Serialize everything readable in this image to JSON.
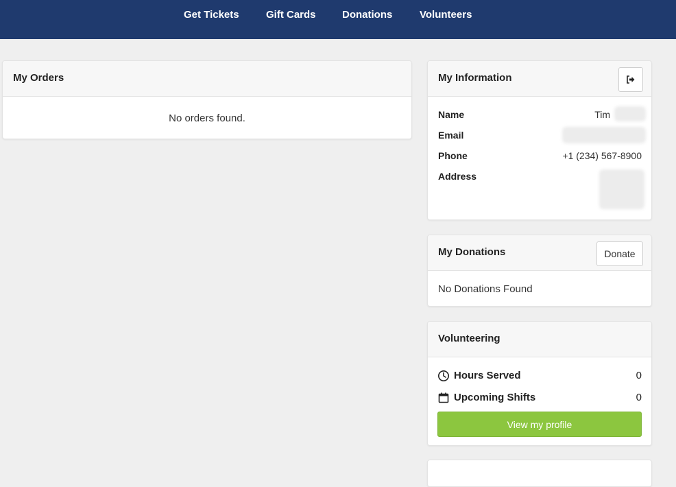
{
  "nav": {
    "items": [
      {
        "label": "Get Tickets"
      },
      {
        "label": "Gift Cards"
      },
      {
        "label": "Donations"
      },
      {
        "label": "Volunteers"
      }
    ]
  },
  "orders": {
    "title": "My Orders",
    "empty_text": "No orders found."
  },
  "information": {
    "title": "My Information",
    "logout_icon": "sign-out-icon",
    "fields": [
      {
        "label": "Name",
        "value": "Tim"
      },
      {
        "label": "Email",
        "value": ""
      },
      {
        "label": "Phone",
        "value": "+1 (234) 567-8900"
      },
      {
        "label": "Address",
        "value": ""
      }
    ]
  },
  "donations": {
    "title": "My Donations",
    "donate_label": "Donate",
    "empty_text": "No Donations Found"
  },
  "volunteering": {
    "title": "Volunteering",
    "stats": [
      {
        "icon": "clock-icon",
        "label": "Hours Served",
        "value": "0"
      },
      {
        "icon": "calendar-icon",
        "label": "Upcoming Shifts",
        "value": "0"
      }
    ],
    "profile_button": "View my profile"
  },
  "colors": {
    "nav_background": "#1f3a6e",
    "accent_green": "#8cc63f",
    "page_background": "#efefef"
  }
}
